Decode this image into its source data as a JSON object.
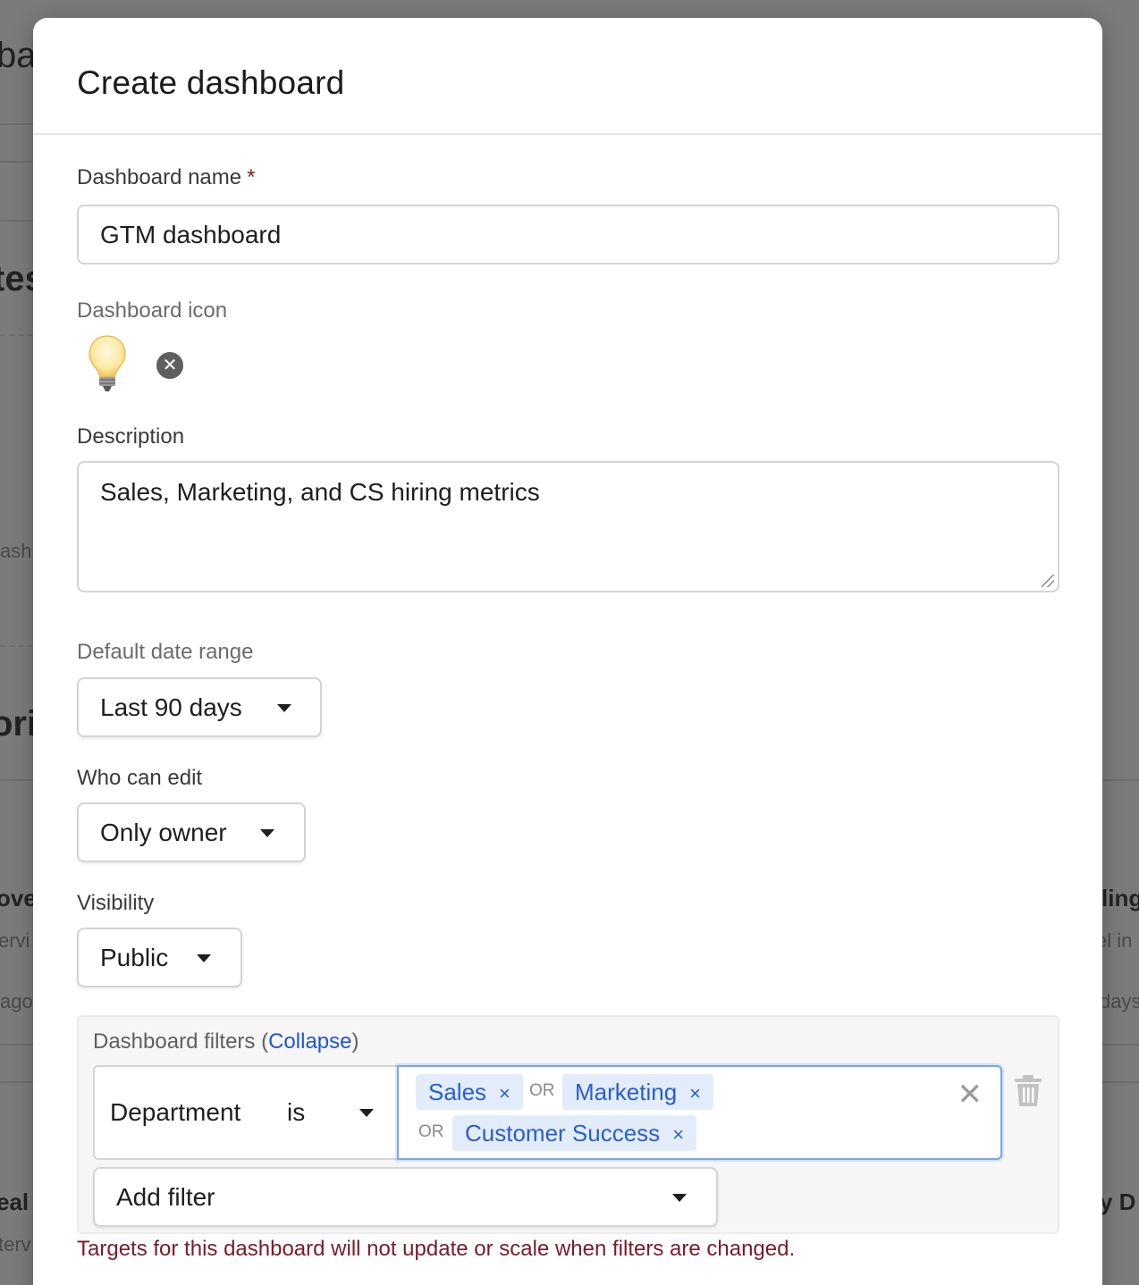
{
  "background": {
    "fragments": [
      "ba",
      "tes",
      "ash",
      "ori",
      "over",
      "ervi",
      "ago",
      "ling",
      "el in",
      "days",
      "eal",
      "terv",
      "y D"
    ]
  },
  "modal": {
    "title": "Create dashboard",
    "dashboard_name": {
      "label": "Dashboard name",
      "required_mark": "*",
      "value": "GTM dashboard"
    },
    "dashboard_icon": {
      "label": "Dashboard icon",
      "icon": "lightbulb-icon",
      "remove_symbol": "✕"
    },
    "description": {
      "label": "Description",
      "value": "Sales, Marketing, and CS hiring metrics"
    },
    "default_date_range": {
      "label": "Default date range",
      "value": "Last 90 days"
    },
    "who_can_edit": {
      "label": "Who can edit",
      "value": "Only owner"
    },
    "visibility": {
      "label": "Visibility",
      "value": "Public"
    },
    "filters": {
      "title": "Dashboard filters",
      "open_paren": "(",
      "collapse_label": "Collapse",
      "close_paren": ")",
      "rows": [
        {
          "field": "Department",
          "operator": "is",
          "values": [
            "Sales",
            "Marketing",
            "Customer Success"
          ],
          "separator": "OR"
        }
      ],
      "chip_remove": "×",
      "clear_symbol": "✕",
      "add_filter_label": "Add filter"
    },
    "warning": "Targets for this dashboard will not update or scale when filters are changed."
  },
  "colors": {
    "link": "#2255cc",
    "chip_bg": "#e2ecfb",
    "chip_text": "#2a5ed1",
    "required": "#7a1b2a",
    "warning": "#7a1b2a",
    "focus_border": "#7aa7e8"
  }
}
